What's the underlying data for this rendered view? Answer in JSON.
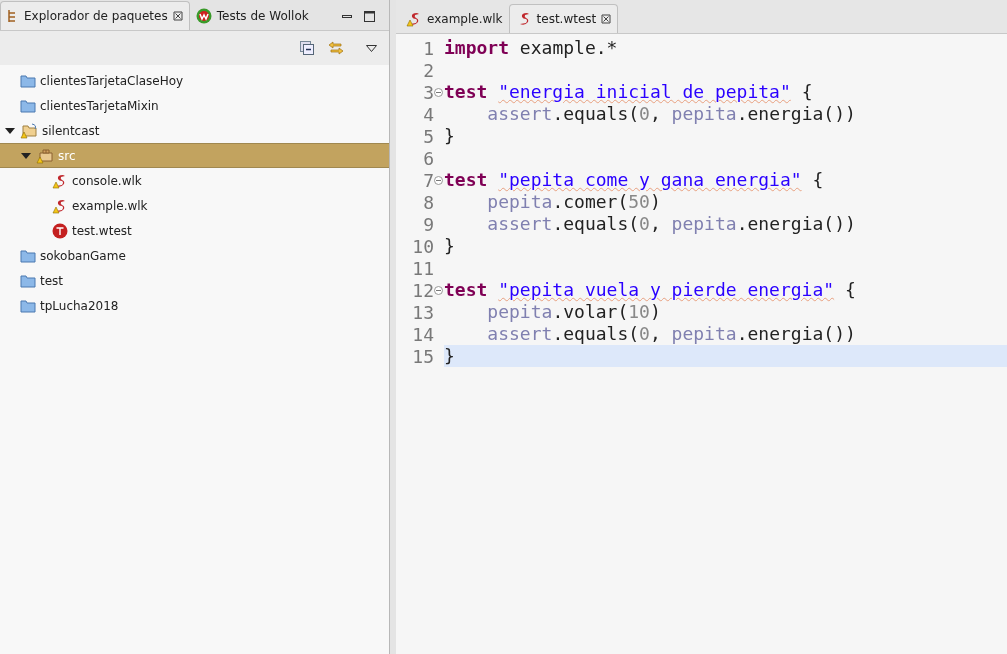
{
  "left_panel": {
    "tabs": [
      {
        "label": "Explorador de paquetes",
        "selected": true
      },
      {
        "label": "Tests de Wollok",
        "selected": false
      }
    ],
    "tree": [
      {
        "label": "clientesTarjetaClaseHoy",
        "kind": "folder",
        "selected": false
      },
      {
        "label": "clientesTarjetaMixin",
        "kind": "folder",
        "selected": false
      },
      {
        "label": "silentcast",
        "kind": "project",
        "selected": false,
        "expanded": true,
        "children": [
          {
            "label": "src",
            "kind": "package",
            "selected": true,
            "expanded": true,
            "children": [
              {
                "label": "console.wlk",
                "kind": "wlk",
                "selected": false
              },
              {
                "label": "example.wlk",
                "kind": "wlk",
                "selected": false
              },
              {
                "label": "test.wtest",
                "kind": "wtest",
                "selected": false
              }
            ]
          }
        ]
      },
      {
        "label": "sokobanGame",
        "kind": "folder",
        "selected": false
      },
      {
        "label": "test",
        "kind": "folder",
        "selected": false
      },
      {
        "label": "tpLucha2018",
        "kind": "folder",
        "selected": false
      }
    ]
  },
  "editor": {
    "tabs": [
      {
        "label": "example.wlk",
        "warning": true,
        "selected": false
      },
      {
        "label": "test.wtest",
        "warning": false,
        "selected": true
      }
    ],
    "lines": [
      {
        "number": "1",
        "foldable": false,
        "current": false,
        "indented": false,
        "tokens": [
          {
            "text": "import",
            "kind": "keyword"
          },
          {
            "text": " example.*",
            "kind": "plain"
          }
        ]
      },
      {
        "number": "2",
        "foldable": false,
        "current": false
      },
      {
        "number": "3",
        "foldable": true,
        "current": false,
        "indented": false,
        "tokens": [
          {
            "text": "test ",
            "kind": "keyword"
          },
          {
            "text": "\"energia inicial de pepita\"",
            "kind": "string"
          },
          {
            "text": " {",
            "kind": "plain"
          }
        ]
      },
      {
        "number": "4",
        "foldable": false,
        "current": false,
        "indented": true,
        "tokens": [
          {
            "text": "assert",
            "kind": "ref"
          },
          {
            "text": ".equals(",
            "kind": "plain"
          },
          {
            "text": "0",
            "kind": "number"
          },
          {
            "text": ", ",
            "kind": "plain"
          },
          {
            "text": "pepita",
            "kind": "ref"
          },
          {
            "text": ".energia())",
            "kind": "plain"
          }
        ]
      },
      {
        "number": "5",
        "foldable": false,
        "current": false,
        "indented": false,
        "tokens": [
          {
            "text": "}",
            "kind": "plain"
          }
        ]
      },
      {
        "number": "6",
        "foldable": false,
        "current": false
      },
      {
        "number": "7",
        "foldable": true,
        "current": false,
        "indented": false,
        "tokens": [
          {
            "text": "test ",
            "kind": "keyword"
          },
          {
            "text": "\"pepita come y gana energia\"",
            "kind": "string"
          },
          {
            "text": " {",
            "kind": "plain"
          }
        ]
      },
      {
        "number": "8",
        "foldable": false,
        "current": false,
        "indented": true,
        "tokens": [
          {
            "text": "pepita",
            "kind": "ref"
          },
          {
            "text": ".comer(",
            "kind": "plain"
          },
          {
            "text": "50",
            "kind": "number"
          },
          {
            "text": ")",
            "kind": "plain"
          }
        ]
      },
      {
        "number": "9",
        "foldable": false,
        "current": false,
        "indented": true,
        "tokens": [
          {
            "text": "assert",
            "kind": "ref"
          },
          {
            "text": ".equals(",
            "kind": "plain"
          },
          {
            "text": "0",
            "kind": "number"
          },
          {
            "text": ", ",
            "kind": "plain"
          },
          {
            "text": "pepita",
            "kind": "ref"
          },
          {
            "text": ".energia())",
            "kind": "plain"
          }
        ]
      },
      {
        "number": "10",
        "foldable": false,
        "current": false,
        "indented": false,
        "tokens": [
          {
            "text": "}",
            "kind": "plain"
          }
        ]
      },
      {
        "number": "11",
        "foldable": false,
        "current": false
      },
      {
        "number": "12",
        "foldable": true,
        "current": false,
        "indented": false,
        "tokens": [
          {
            "text": "test ",
            "kind": "keyword"
          },
          {
            "text": "\"pepita vuela y pierde energia\"",
            "kind": "string"
          },
          {
            "text": " {",
            "kind": "plain"
          }
        ]
      },
      {
        "number": "13",
        "foldable": false,
        "current": false,
        "indented": true,
        "tokens": [
          {
            "text": "pepita",
            "kind": "ref"
          },
          {
            "text": ".volar(",
            "kind": "plain"
          },
          {
            "text": "10",
            "kind": "number"
          },
          {
            "text": ")",
            "kind": "plain"
          }
        ]
      },
      {
        "number": "14",
        "foldable": false,
        "current": false,
        "indented": true,
        "tokens": [
          {
            "text": "assert",
            "kind": "ref"
          },
          {
            "text": ".equals(",
            "kind": "plain"
          },
          {
            "text": "0",
            "kind": "number"
          },
          {
            "text": ", ",
            "kind": "plain"
          },
          {
            "text": "pepita",
            "kind": "ref"
          },
          {
            "text": ".energia())",
            "kind": "plain"
          }
        ]
      },
      {
        "number": "15",
        "foldable": false,
        "current": true,
        "indented": false,
        "tokens": [
          {
            "text": "}",
            "kind": "plain"
          }
        ]
      }
    ]
  }
}
